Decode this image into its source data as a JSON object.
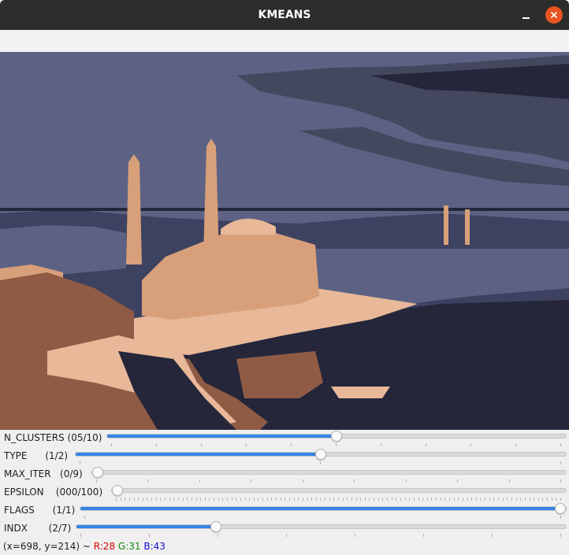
{
  "window": {
    "title": "KMEANS"
  },
  "trackbars": [
    {
      "label": "N_CLUSTERS (05/10)",
      "value": 5,
      "max": 10
    },
    {
      "label": "TYPE      (1/2)",
      "value": 1,
      "max": 2
    },
    {
      "label": "MAX_ITER   (0/9)",
      "value": 0,
      "max": 9
    },
    {
      "label": "EPSILON    (000/100)",
      "value": 0,
      "max": 100
    },
    {
      "label": "FLAGS      (1/1)",
      "value": 1,
      "max": 1
    },
    {
      "label": "INDX       (2/7)",
      "value": 2,
      "max": 7
    }
  ],
  "status": {
    "coords": "(x=698, y=214) ~ ",
    "r": "R:28",
    "g": "G:31",
    "b": "B:43"
  },
  "palette": {
    "sky": "#5d6284",
    "cloud_dark": "#44485f",
    "water": "#3d4260",
    "shadow": "#25263a",
    "beige": "#d8a07a",
    "brown": "#8f5b45",
    "light": "#e8b898",
    "accent": "#3584e4"
  }
}
